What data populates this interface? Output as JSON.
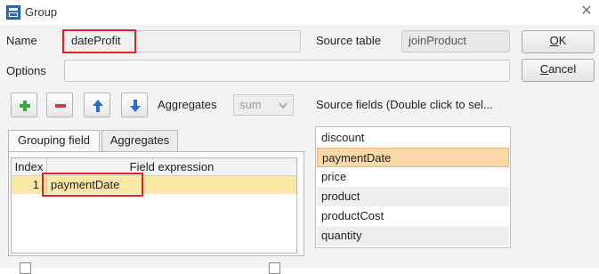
{
  "window": {
    "title": "Group"
  },
  "form": {
    "name_label": "Name",
    "name_value": "dateProfit",
    "source_table_label": "Source table",
    "source_table_value": "joinProduct",
    "options_label": "Options",
    "options_value": ""
  },
  "buttons": {
    "ok_prefix": "",
    "ok_mnemonic": "O",
    "ok_rest": "K",
    "cancel_mnemonic": "C",
    "cancel_rest": "ancel"
  },
  "toolbar": {
    "aggregates_label": "Aggregates",
    "aggregates_value": "sum"
  },
  "source_fields": {
    "header": "Source fields (Double click to sel...",
    "items": [
      "discount",
      "paymentDate",
      "price",
      "product",
      "productCost",
      "quantity"
    ],
    "selected_index": 1
  },
  "tabs": [
    {
      "label": "Grouping field",
      "active": true
    },
    {
      "label": "Aggregates",
      "active": false
    }
  ],
  "grouping_table": {
    "columns": [
      "Index",
      "Field expression"
    ],
    "rows": [
      {
        "index": "1",
        "expression": "paymentDate"
      }
    ]
  },
  "colors": {
    "highlight_box": "#e02424",
    "selected_row": "#fbe7a6",
    "selected_list_item": "#fad8a8",
    "add_icon": "#3aa83a",
    "remove_icon": "#d23b3b",
    "arrow_icon": "#2d6fd1"
  }
}
